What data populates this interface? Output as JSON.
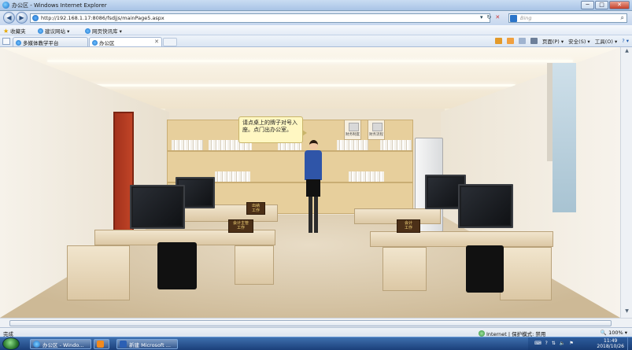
{
  "window": {
    "title": "办公区 - Windows Internet Explorer",
    "controls": {
      "minimize": "─",
      "maximize": "□",
      "close": "✕"
    }
  },
  "address_bar": {
    "url": "http://192.168.1.17:8086/fsdjjs/mainPage5.aspx",
    "search_placeholder": "Bing",
    "search_icon_glyph": "⌕",
    "dropdown_glyph": "▾",
    "refresh_glyph": "↻",
    "stop_glyph": "✕",
    "back_glyph": "◀",
    "forward_glyph": "▶"
  },
  "favorites_bar": {
    "favorites_label": "收藏夹",
    "suggested_sites": "建议网站 ▾",
    "web_slice": "网页快讯库 ▾"
  },
  "tabs": [
    {
      "label": "多媒体教学平台",
      "active": false
    },
    {
      "label": "办公区",
      "active": true
    }
  ],
  "command_bar": {
    "page_menu": "页面(P) ▾",
    "safety_menu": "安全(S) ▾",
    "tools_menu": "工具(O) ▾",
    "help_menu": "? ▾"
  },
  "scene": {
    "speech_text": "请点桌上的牌子对号入座。点门出办公室。",
    "wall_signs": [
      "财务制度",
      "财务流程"
    ],
    "nameplates": [
      {
        "label": "出纳\n工作"
      },
      {
        "label": "会计主管\n工作"
      },
      {
        "label": "会计\n工作"
      }
    ]
  },
  "status_bar": {
    "status": "完成",
    "zone": "Internet | 保护模式: 禁用",
    "zoom": "100%"
  },
  "taskbar": {
    "ie_item": "办公区 - Windo...",
    "word_item": "新建 Microsoft ...",
    "time": "11:49",
    "date": "2018/10/26"
  },
  "colors": {
    "titlebar": "#a9c4e6",
    "taskbar": "#1b3f7a",
    "door": "#c04427",
    "shirt": "#2f55a8",
    "speech_bg": "#fff7c2"
  }
}
